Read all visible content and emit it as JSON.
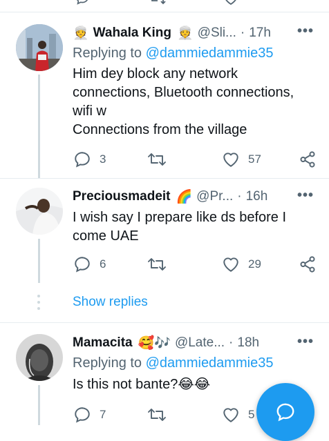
{
  "tweets": [
    {
      "name": "Wahala King",
      "name_prefix_emoji": "👳",
      "name_suffix_emoji": "👳",
      "handle": "@Sli...",
      "time": "17h",
      "replying_label": "Replying to",
      "replying_to": "@dammiedammie35",
      "body_lines": [
        "Him dey block any network",
        "connections, Bluetooth connections,",
        "wifi w",
        "Connections from the village"
      ],
      "replies": "3",
      "retweets": "",
      "likes": "57"
    },
    {
      "name": "Preciousmadeit",
      "name_suffix_emoji": "🌈",
      "handle": "@Pr...",
      "time": "16h",
      "body_lines": [
        "I wish say I prepare like ds before I",
        "come UAE"
      ],
      "replies": "6",
      "retweets": "",
      "likes": "29"
    },
    {
      "name": "Mamacita",
      "name_suffix_emoji": "🥰🎶",
      "handle": "@Late...",
      "time": "18h",
      "replying_label": "Replying to",
      "replying_to": "@dammiedammie35",
      "body_lines": [
        "Is this not bante?😂😂"
      ],
      "replies": "7",
      "retweets": "",
      "likes": "5"
    }
  ],
  "show_replies": "Show replies",
  "time_separator": "·",
  "icons": {
    "more": "more-options-icon",
    "reply": "reply-icon",
    "retweet": "retweet-icon",
    "like": "heart-icon",
    "share": "share-icon",
    "compose": "compose-reply-icon"
  },
  "colors": {
    "accent": "#1d9bf0",
    "secondary_text": "#536471",
    "primary_text": "#0f1419",
    "divider": "#e6ecf0"
  }
}
